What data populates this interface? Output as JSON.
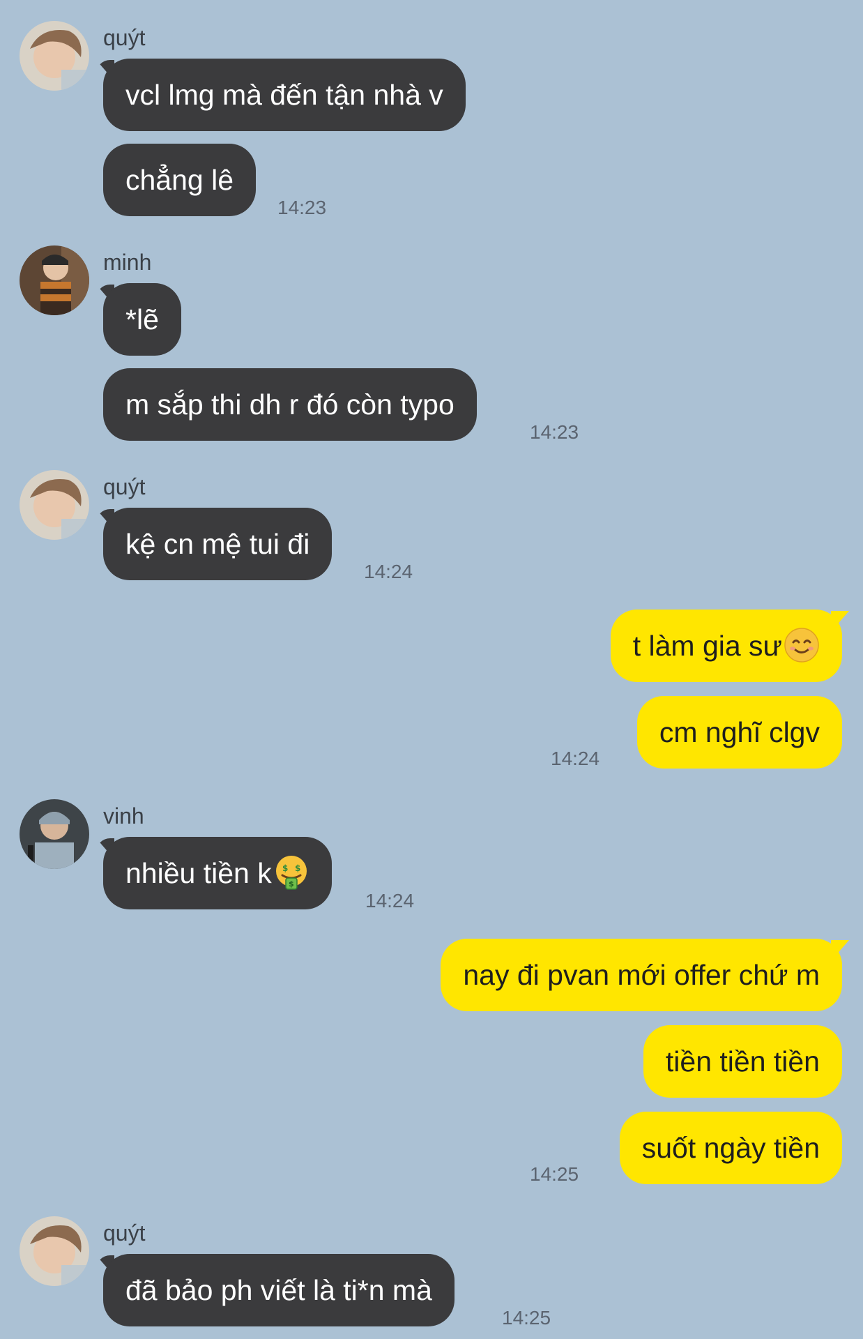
{
  "colors": {
    "background": "#abc1d4",
    "incoming_bubble": "#3b3b3d",
    "outgoing_bubble": "#ffe600"
  },
  "messages": [
    {
      "sender": "quýt",
      "avatar": "person-avatar-icon",
      "bubbles": [
        "vcl lmg mà đến tận nhà v",
        "chẳng lê"
      ],
      "time": "14:23"
    },
    {
      "sender": "minh",
      "avatar": "person-avatar-icon",
      "bubbles": [
        "*lẽ",
        "m sắp thi dh r đó còn typo"
      ],
      "time": "14:23"
    },
    {
      "sender": "quýt",
      "avatar": "person-avatar-icon",
      "bubbles": [
        "kệ cn mệ tui đi"
      ],
      "time": "14:24"
    },
    {
      "sender": "me",
      "bubbles": [
        "t làm gia sư",
        "cm nghĩ clgv"
      ],
      "emoji_first": "smiling-face-emoji",
      "time": "14:24"
    },
    {
      "sender": "vinh",
      "avatar": "person-avatar-icon",
      "bubbles": [
        "nhiều tiền k"
      ],
      "emoji_first": "money-mouth-face-emoji",
      "time": "14:24"
    },
    {
      "sender": "me",
      "bubbles": [
        "nay đi pvan mới offer chứ m",
        "tiền tiền tiền",
        "suốt ngày tiền"
      ],
      "time": "14:25"
    },
    {
      "sender": "quýt",
      "avatar": "person-avatar-icon",
      "bubbles": [
        "đã bảo ph viết là ti*n mà"
      ],
      "time": "14:25"
    }
  ]
}
